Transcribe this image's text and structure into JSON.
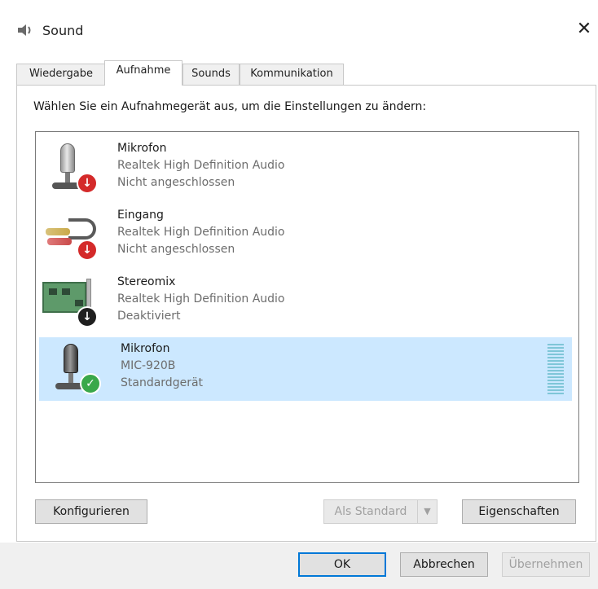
{
  "window": {
    "title": "Sound",
    "close_glyph": "✕",
    "title_icon": "speaker-icon"
  },
  "tabs": [
    {
      "label": "Wiedergabe",
      "active": false
    },
    {
      "label": "Aufnahme",
      "active": true
    },
    {
      "label": "Sounds",
      "active": false
    },
    {
      "label": "Kommunikation",
      "active": false
    }
  ],
  "instruction": "Wählen Sie ein Aufnahmegerät aus, um die Einstellungen zu ändern:",
  "devices": [
    {
      "name": "Mikrofon",
      "driver": "Realtek High Definition Audio",
      "status": "Nicht angeschlossen",
      "icon": "microphone-icon",
      "badge": "unplugged-badge-icon",
      "selected": false
    },
    {
      "name": "Eingang",
      "driver": "Realtek High Definition Audio",
      "status": "Nicht angeschlossen",
      "icon": "line-in-cable-icon",
      "badge": "unplugged-badge-icon",
      "selected": false
    },
    {
      "name": "Stereomix",
      "driver": "Realtek High Definition Audio",
      "status": "Deaktiviert",
      "icon": "sound-card-icon",
      "badge": "disabled-badge-icon",
      "selected": false
    },
    {
      "name": "Mikrofon",
      "driver": "MIC-920B",
      "status": "Standardgerät",
      "icon": "microphone-icon",
      "badge": "default-check-icon",
      "selected": true
    }
  ],
  "buttons": {
    "configure": "Konfigurieren",
    "set_default": "Als Standard",
    "properties": "Eigenschaften",
    "ok": "OK",
    "cancel": "Abbrechen",
    "apply": "Übernehmen"
  },
  "colors": {
    "selection": "#cce8ff",
    "focus_border": "#0078d7",
    "unplugged_badge": "#d42a2a",
    "default_badge": "#3aa84a"
  }
}
